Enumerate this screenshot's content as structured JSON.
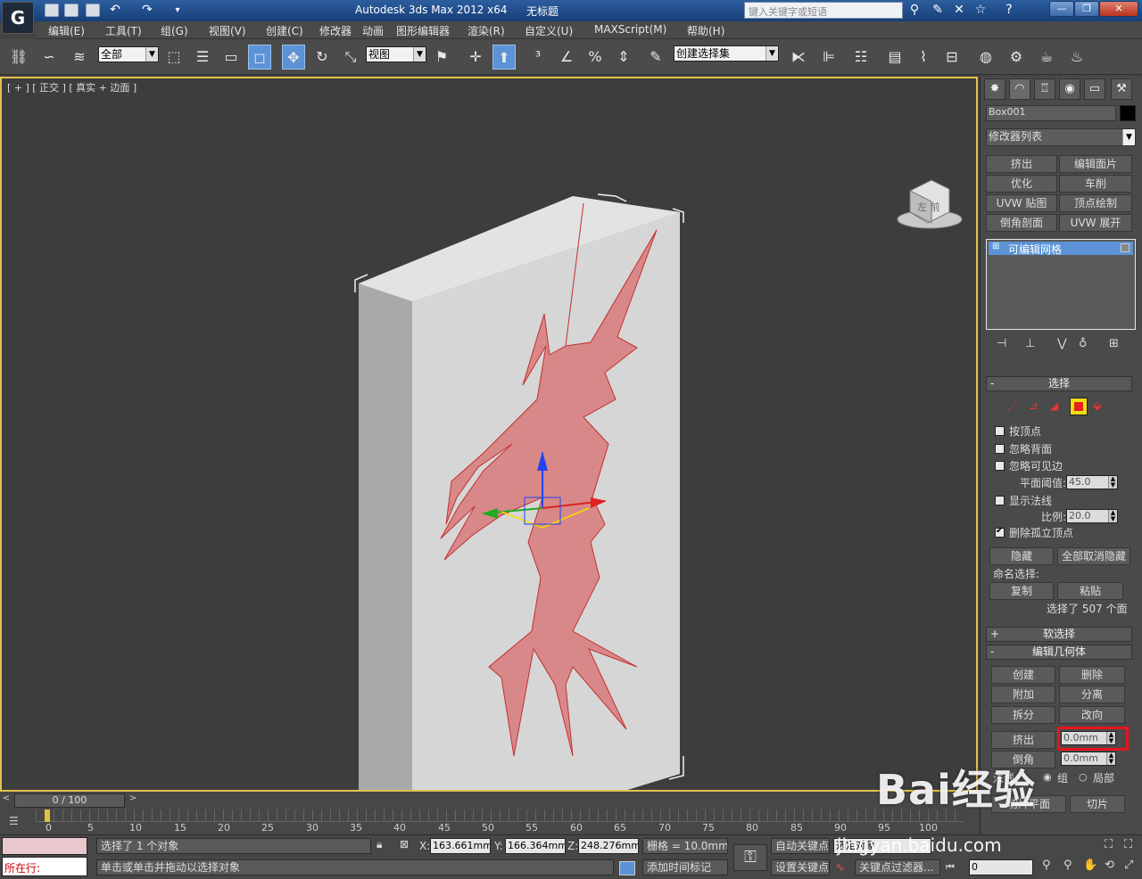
{
  "titlebar": {
    "title": "Autodesk 3ds Max  2012 x64",
    "doc": "无标题",
    "search_placeholder": "键入关键字或短语"
  },
  "menu": [
    "编辑(E)",
    "工具(T)",
    "组(G)",
    "视图(V)",
    "创建(C)",
    "修改器",
    "动画",
    "图形编辑器",
    "渲染(R)",
    "自定义(U)",
    "MAXScript(M)",
    "帮助(H)"
  ],
  "toolbar": {
    "filter": "全部",
    "ref_coord": "视图",
    "selection_set": "创建选择集"
  },
  "viewport": {
    "label": "[ + ] [ 正交 ] [ 真实 + 边面 ]",
    "viewcube_label": "左 前"
  },
  "panel": {
    "object_name": "Box001",
    "object_color": "#000000",
    "modifier_list": "修改器列表",
    "modifier_buttons": [
      "挤出",
      "编辑面片",
      "优化",
      "车削",
      "UVW 贴图",
      "顶点绘制",
      "倒角剖面",
      "UVW 展开"
    ],
    "stack_item": "可编辑网格",
    "selection_rollout": "选择",
    "by_vertex": "按顶点",
    "ignore_backface": "忽略背面",
    "ignore_visible_edges": "忽略可见边",
    "planar_threshold_label": "平面阈值:",
    "planar_threshold": "45.0",
    "show_normals": "显示法线",
    "scale_label": "比例:",
    "scale": "20.0",
    "delete_isolated": "删除孤立顶点",
    "hide": "隐藏",
    "unhide_all": "全部取消隐藏",
    "named_selection": "命名选择:",
    "copy": "复制",
    "paste": "粘贴",
    "selected_count": "选择了 507 个面",
    "soft_selection": "软选择",
    "edit_geometry": "编辑几何体",
    "create": "创建",
    "delete": "删除",
    "attach": "附加",
    "detach": "分离",
    "break": "拆分",
    "turn": "改向",
    "extrude": "挤出",
    "extrude_value": "0.0mm",
    "bevel": "倒角",
    "bevel_value": "0.0mm",
    "normal_label": "法线:",
    "group": "组",
    "local": "局部",
    "slice_plane": "切片平面",
    "slice": "切片"
  },
  "timeline": {
    "frame": "0 / 100",
    "ticks": [
      "0",
      "5",
      "10",
      "15",
      "20",
      "25",
      "30",
      "35",
      "40",
      "45",
      "50",
      "55",
      "60",
      "65",
      "70",
      "75",
      "80",
      "85",
      "90",
      "95",
      "100"
    ]
  },
  "status": {
    "now_label": "所在行:",
    "selected": "选择了 1 个对象",
    "hint": "单击或单击并拖动以选择对象",
    "x": "163.661mm",
    "y": "166.364mm",
    "z": "248.276mm",
    "grid": "栅格 = 10.0mm",
    "add_time_tag": "添加时间标记",
    "auto_key": "自动关键点",
    "set_key": "设置关键点",
    "selected_object": "选定对象",
    "key_filters": "关键点过滤器...",
    "current_frame": "0"
  },
  "watermark": {
    "brand": "Bai经验",
    "url": "jingyan.baidu.com"
  },
  "colors": {
    "accent": "#5b93d6",
    "viewport_border": "#e2c34a",
    "shape_fill": "#d88888",
    "annotation_red": "#e8141e"
  }
}
